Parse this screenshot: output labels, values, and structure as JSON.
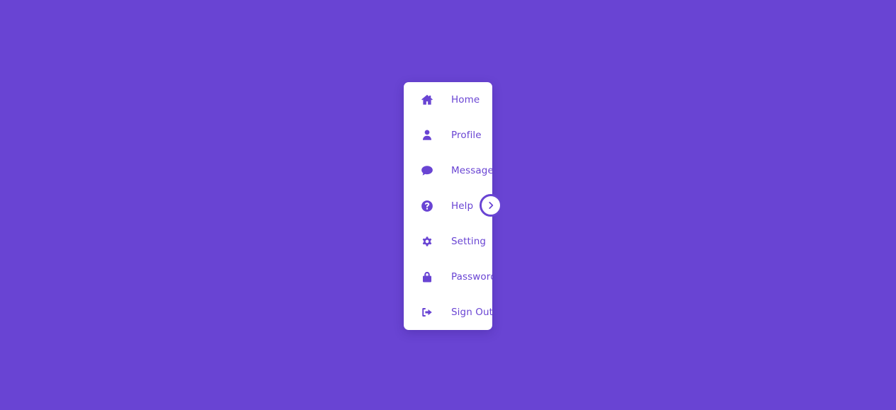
{
  "theme": {
    "background": "#6944d3",
    "accent": "#6944d3",
    "panel": "#ffffff"
  },
  "sidebar": {
    "items": [
      {
        "label": "Home",
        "icon": "home-icon"
      },
      {
        "label": "Profile",
        "icon": "user-icon"
      },
      {
        "label": "Message",
        "icon": "chat-icon"
      },
      {
        "label": "Help",
        "icon": "question-circle-icon"
      },
      {
        "label": "Setting",
        "icon": "gear-icon"
      },
      {
        "label": "Password",
        "icon": "lock-icon"
      },
      {
        "label": "Sign Out",
        "icon": "sign-out-icon"
      }
    ],
    "toggle": {
      "icon": "chevron-right-icon",
      "expanded": false
    }
  }
}
